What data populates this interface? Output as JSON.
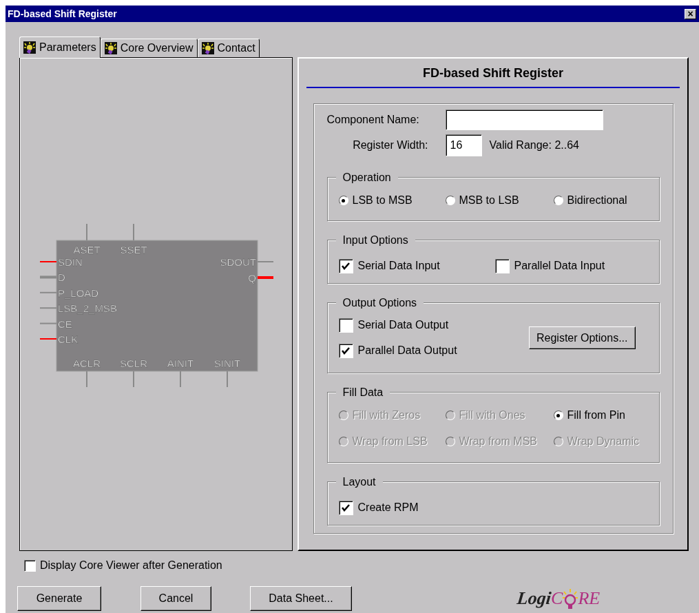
{
  "window": {
    "title": "FD-based Shift Register",
    "close": "×"
  },
  "tabs": [
    {
      "label": "Parameters",
      "selected": true
    },
    {
      "label": "Core Overview",
      "selected": false
    },
    {
      "label": "Contact",
      "selected": false
    }
  ],
  "symbol": {
    "top_pins": [
      {
        "label": "ASET",
        "active": false,
        "bus": false
      },
      {
        "label": "SSET",
        "active": false,
        "bus": false
      }
    ],
    "left_pins": [
      {
        "label": "SDIN",
        "active": true,
        "bus": false
      },
      {
        "label": "D",
        "active": false,
        "bus": true
      },
      {
        "label": "P_LOAD",
        "active": false,
        "bus": false
      },
      {
        "label": "LSB_2_MSB",
        "active": false,
        "bus": false
      },
      {
        "label": "CE",
        "active": false,
        "bus": false
      },
      {
        "label": "CLK",
        "active": true,
        "bus": false
      }
    ],
    "right_pins": [
      {
        "label": "SDOUT",
        "active": false,
        "bus": false
      },
      {
        "label": "Q",
        "active": true,
        "bus": true
      }
    ],
    "bottom_pins": [
      {
        "label": "ACLR",
        "active": false,
        "bus": false
      },
      {
        "label": "SCLR",
        "active": false,
        "bus": false
      },
      {
        "label": "AINIT",
        "active": false,
        "bus": false
      },
      {
        "label": "SINIT",
        "active": false,
        "bus": false
      }
    ]
  },
  "panel_title": "FD-based Shift Register",
  "component_name": {
    "label": "Component Name:"
  },
  "register_width": {
    "label": "Register Width:",
    "value": "16",
    "hint": "Valid Range: 2..64"
  },
  "groups": [
    {
      "title": "Operation",
      "kind": "radios",
      "options": [
        {
          "label": "LSB to MSB",
          "selected": true,
          "disabled": false
        },
        {
          "label": "MSB to LSB",
          "selected": false,
          "disabled": false
        },
        {
          "label": "Bidirectional",
          "selected": false,
          "disabled": false
        }
      ]
    },
    {
      "title": "Input Options",
      "kind": "checks",
      "options": [
        {
          "label": "Serial Data Input",
          "checked": true
        },
        {
          "label": "Parallel Data Input",
          "checked": false
        }
      ]
    },
    {
      "title": "Output Options",
      "kind": "checks_button",
      "options": [
        {
          "label": "Serial Data Output",
          "checked": false
        },
        {
          "label": "Parallel Data Output",
          "checked": true
        }
      ],
      "button": "Register Options..."
    },
    {
      "title": "Fill Data",
      "kind": "radios",
      "options": [
        {
          "label": "Fill with Zeros",
          "selected": false,
          "disabled": true
        },
        {
          "label": "Fill with Ones",
          "selected": false,
          "disabled": true
        },
        {
          "label": "Fill from Pin",
          "selected": true,
          "disabled": false
        },
        {
          "label": "Wrap from LSB",
          "selected": false,
          "disabled": true
        },
        {
          "label": "Wrap from MSB",
          "selected": false,
          "disabled": true
        },
        {
          "label": "Wrap Dynamic",
          "selected": false,
          "disabled": true
        }
      ]
    },
    {
      "title": "Layout",
      "kind": "checks",
      "options": [
        {
          "label": "Create RPM",
          "checked": true
        }
      ]
    }
  ],
  "display_viewer": {
    "label": "Display Core Viewer after Generation",
    "checked": false
  },
  "buttons": [
    "Generate",
    "Cancel",
    "Data Sheet..."
  ],
  "logo": {
    "part_1": "Logi",
    "part_2": "C",
    "part_3": "RE"
  }
}
